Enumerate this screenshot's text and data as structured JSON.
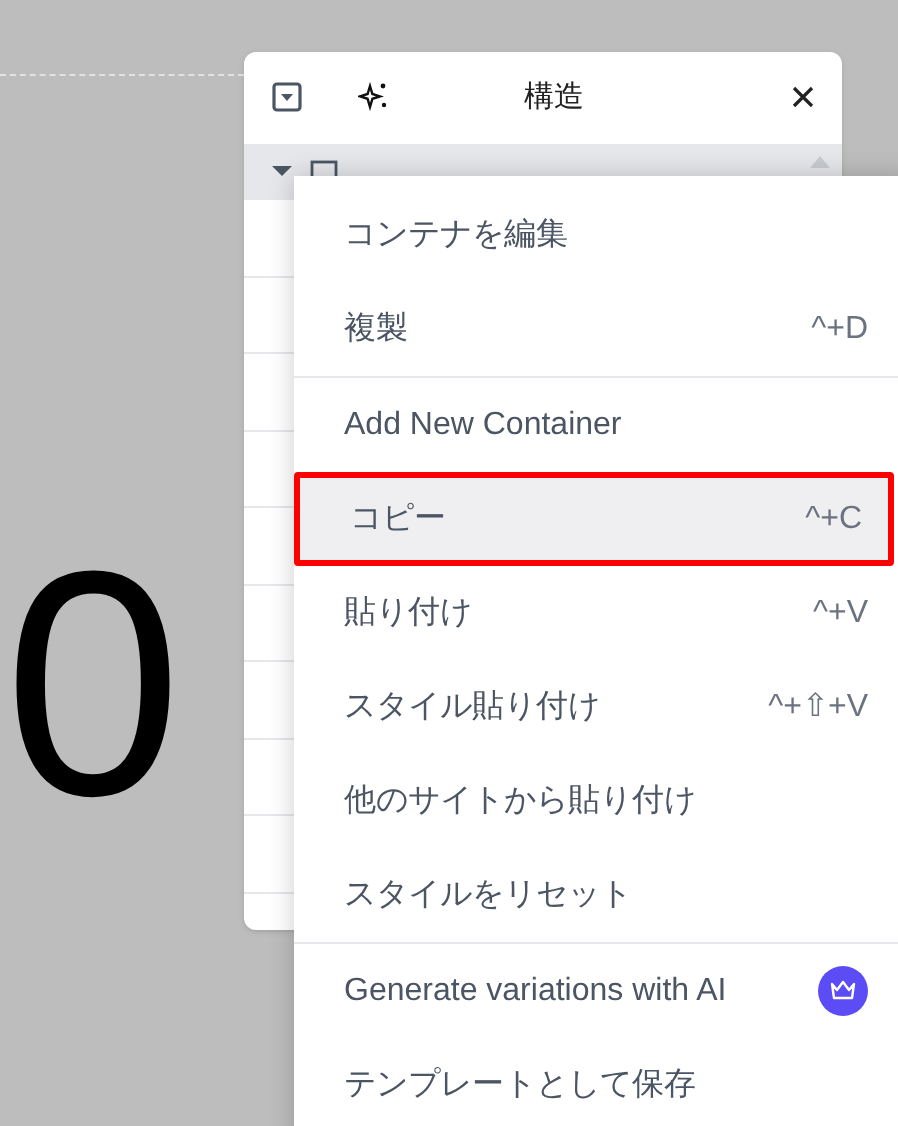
{
  "canvas": {
    "heading": "0"
  },
  "structure_panel": {
    "title": "構造",
    "rows": [
      {
        "expanded": true,
        "selected": true
      },
      {
        "selected": false
      },
      {
        "selected": false
      },
      {
        "selected": false
      },
      {
        "selected": false
      },
      {
        "selected": false
      },
      {
        "selected": false
      },
      {
        "selected": false
      },
      {
        "selected": false
      },
      {
        "selected": false
      }
    ]
  },
  "context_menu": {
    "groups": [
      [
        {
          "label": "コンテナを編集",
          "selected": false,
          "marked": false
        },
        {
          "label": "複製",
          "shortcut": "^+D",
          "selected": false,
          "marked": false
        }
      ],
      [
        {
          "label": "Add New Container",
          "selected": false,
          "marked": false
        },
        {
          "label": "コピー",
          "shortcut": "^+C",
          "selected": true,
          "marked": true
        },
        {
          "label": "貼り付け",
          "shortcut": "^+V",
          "selected": false,
          "marked": false
        },
        {
          "label": "スタイル貼り付け",
          "shortcut": "^+⇧+V",
          "selected": false,
          "marked": false
        },
        {
          "label": "他のサイトから貼り付け",
          "selected": false,
          "marked": false
        },
        {
          "label": "スタイルをリセット",
          "selected": false,
          "marked": false
        }
      ],
      [
        {
          "label": "Generate variations with AI",
          "pro": true,
          "selected": false,
          "marked": false
        },
        {
          "label": "テンプレートとして保存",
          "selected": false,
          "marked": false
        }
      ]
    ]
  }
}
